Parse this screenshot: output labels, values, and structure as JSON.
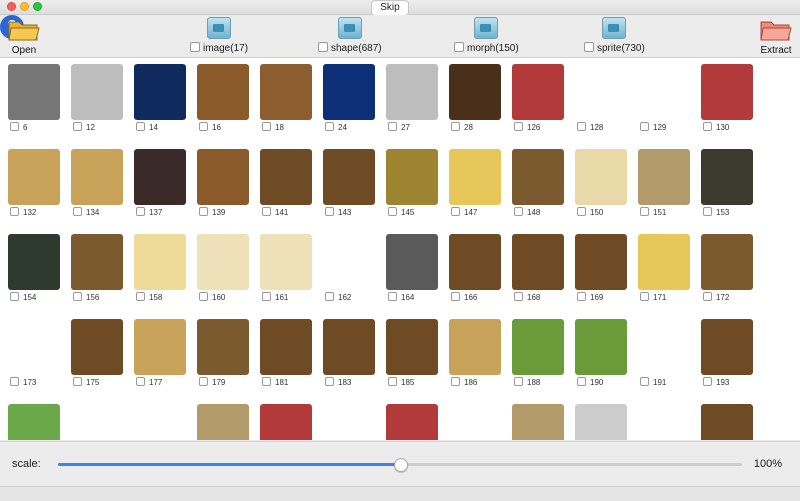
{
  "toolbar": {
    "open_label": "Open",
    "skip_label": "Skip",
    "extract_label": "Extract",
    "help_glyph": "?",
    "categories": [
      {
        "label": "image(17)",
        "icon": "folder-image-icon"
      },
      {
        "label": "shape(687)",
        "icon": "folder-image-icon"
      },
      {
        "label": "morph(150)",
        "icon": "folder-image-icon"
      },
      {
        "label": "sprite(730)",
        "icon": "folder-image-icon"
      }
    ]
  },
  "grid": {
    "items": [
      {
        "id": "6",
        "color": "#a9d06b"
      },
      {
        "id": "12",
        "color": "#bdbdbd"
      },
      {
        "id": "14",
        "color": "#0f2a5e"
      },
      {
        "id": "16",
        "color": "#8a5a2b"
      },
      {
        "id": "18",
        "color": "#8c5d2e"
      },
      {
        "id": "24",
        "color": "#0d2f78"
      },
      {
        "id": "27",
        "color": "#bdbdbd"
      },
      {
        "id": "28",
        "color": "#4a2f1a"
      },
      {
        "id": "126",
        "color": "#b33a3a"
      },
      {
        "id": "128",
        "color": "#ffffff"
      },
      {
        "id": "129",
        "color": "#ffffff"
      },
      {
        "id": "130",
        "color": "#b33a3a"
      },
      {
        "id": "132",
        "color": "#c9a25a"
      },
      {
        "id": "134",
        "color": "#c9a25a"
      },
      {
        "id": "137",
        "color": "#3a2a2a"
      },
      {
        "id": "139",
        "color": "#8a5a2b"
      },
      {
        "id": "141",
        "color": "#6e4a25"
      },
      {
        "id": "143",
        "color": "#6e4a25"
      },
      {
        "id": "145",
        "color": "#9c8431"
      },
      {
        "id": "147",
        "color": "#e8c75a"
      },
      {
        "id": "148",
        "color": "#7a5a2e"
      },
      {
        "id": "150",
        "color": "#e9d9a8"
      },
      {
        "id": "151",
        "color": "#b39a6a"
      },
      {
        "id": "153",
        "color": "#3a3a2e"
      },
      {
        "id": "154",
        "color": "#2e3a2e"
      },
      {
        "id": "156",
        "color": "#7a5a2e"
      },
      {
        "id": "158",
        "color": "#eedb9a"
      },
      {
        "id": "160",
        "color": "#eee0b8"
      },
      {
        "id": "161",
        "color": "#eee0b8"
      },
      {
        "id": "162",
        "color": "#ffffff"
      },
      {
        "id": "164",
        "color": "#5a5a5a"
      },
      {
        "id": "166",
        "color": "#6e4a25"
      },
      {
        "id": "168",
        "color": "#6e4a25"
      },
      {
        "id": "169",
        "color": "#6e4a25"
      },
      {
        "id": "171",
        "color": "#e8c75a"
      },
      {
        "id": "172",
        "color": "#7a5a2e"
      },
      {
        "id": "173",
        "color": "#ffffff"
      },
      {
        "id": "175",
        "color": "#6e4a25"
      },
      {
        "id": "177",
        "color": "#c9a25a"
      },
      {
        "id": "179",
        "color": "#7a5a2e"
      },
      {
        "id": "181",
        "color": "#6e4a25"
      },
      {
        "id": "183",
        "color": "#6e4a25"
      },
      {
        "id": "185",
        "color": "#6e4a25"
      },
      {
        "id": "186",
        "color": "#c9a25a"
      },
      {
        "id": "188",
        "color": "#6a9a3a"
      },
      {
        "id": "190",
        "color": "#6a9a3a"
      },
      {
        "id": "191",
        "color": "#ffffff"
      },
      {
        "id": "193",
        "color": "#6e4a25"
      },
      {
        "id": "",
        "color": "#6aa84a"
      },
      {
        "id": "",
        "color": "#ffffff"
      },
      {
        "id": "",
        "color": "#ffffff"
      },
      {
        "id": "",
        "color": "#b39a6a"
      },
      {
        "id": "",
        "color": "#b33a3a"
      },
      {
        "id": "",
        "color": "#ffffff"
      },
      {
        "id": "",
        "color": "#b33a3a"
      },
      {
        "id": "",
        "color": "#ffffff"
      },
      {
        "id": "",
        "color": "#b39a6a"
      },
      {
        "id": "",
        "color": "#cccccc"
      },
      {
        "id": "",
        "color": "#ffffff"
      },
      {
        "id": "",
        "color": "#6e4a25"
      },
      {
        "id": "",
        "color": "#777777"
      }
    ]
  },
  "scale": {
    "label": "scale:",
    "value_text": "100%",
    "fraction": 0.5
  }
}
